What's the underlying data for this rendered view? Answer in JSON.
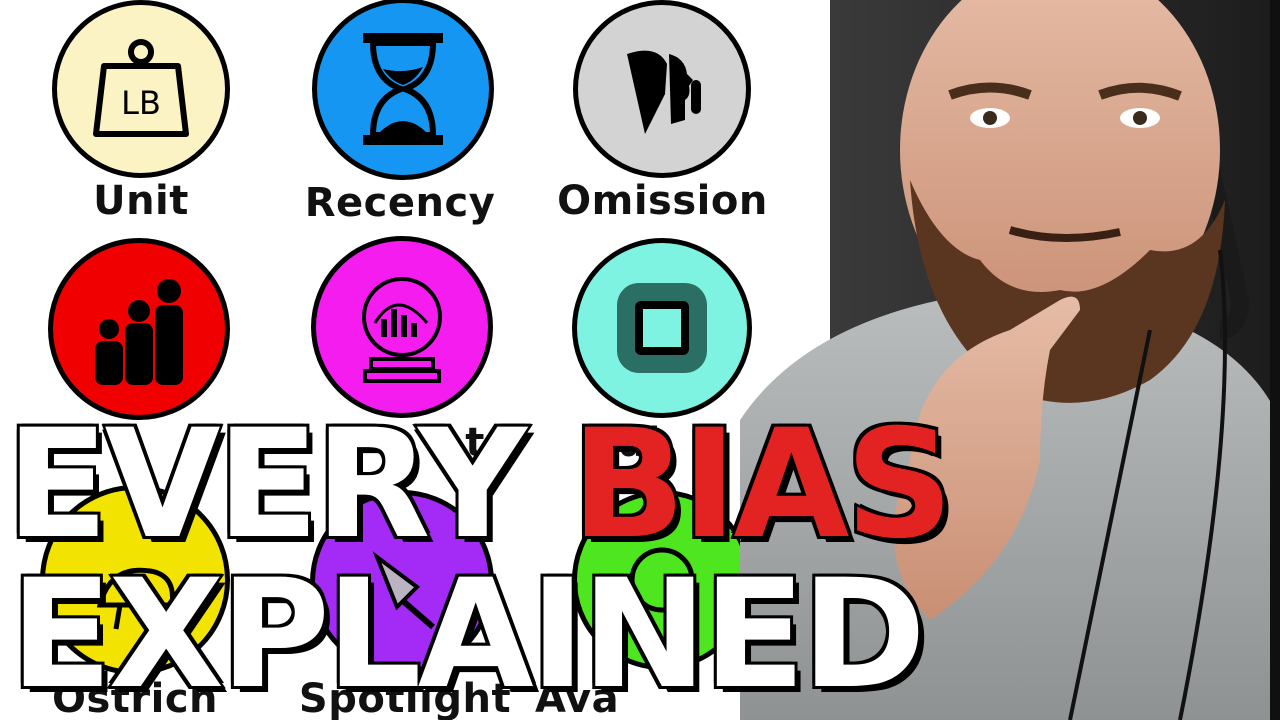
{
  "thumbnail": {
    "headline_line1_prefix": "EVERY",
    "headline_line1_highlight": "BIAS",
    "headline_line2": "EXPLAINED",
    "highlight_color": "#e32222"
  },
  "bias_icons": [
    {
      "label": "Unit",
      "icon": "weight-lb-icon",
      "color": "#fbf3c4"
    },
    {
      "label": "Recency",
      "icon": "hourglass-icon",
      "color": "#1496f2"
    },
    {
      "label": "Omission",
      "icon": "shush-face-icon",
      "color": "#d3d3d3"
    },
    {
      "label": "",
      "icon": "family-silhouettes-icon",
      "color": "#f00000"
    },
    {
      "label": "",
      "icon": "crystal-ball-chart-icon",
      "color": "#f51cf0"
    },
    {
      "label": "",
      "icon": "square-stop-icon",
      "color": "#7ff3e2"
    },
    {
      "label": "Ostrich",
      "icon": "ostrich-icon",
      "color": "#f2e400"
    },
    {
      "label": "Spotlight",
      "icon": "spotlight-icon",
      "color": "#a42bf5"
    },
    {
      "label": "Ava",
      "icon": "availability-icon",
      "color": "#4ee61e"
    }
  ],
  "partial_labels": {
    "row2_col2_fragment": "t",
    "row2_col3_fragment": "al"
  }
}
